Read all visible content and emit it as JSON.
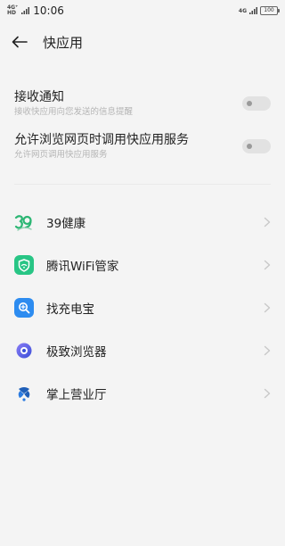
{
  "status_bar": {
    "signal_text": "4G⁺",
    "hd_text": "HD",
    "time": "10:06",
    "network_text": "4G",
    "battery_text": "100"
  },
  "header": {
    "back_icon": "arrow-left-icon",
    "title": "快应用"
  },
  "settings": [
    {
      "title": "接收通知",
      "description": "接收快应用向您发送的信息提醒",
      "enabled": false
    },
    {
      "title": "允许浏览网页时调用快应用服务",
      "description": "允许网页调用快应用服务",
      "enabled": false
    }
  ],
  "apps": [
    {
      "name": "39健康",
      "icon": "39-health-icon",
      "color": "#2bb673"
    },
    {
      "name": "腾讯WiFi管家",
      "icon": "shield-wifi-icon",
      "color": "#28c585"
    },
    {
      "name": "找充电宝",
      "icon": "search-plus-icon",
      "color": "#2d8cf0"
    },
    {
      "name": "极致浏览器",
      "icon": "browser-orb-icon",
      "color": "#5a5fe0"
    },
    {
      "name": "掌上营业厅",
      "icon": "unicom-knot-icon",
      "color": "#1f5fb8"
    }
  ]
}
